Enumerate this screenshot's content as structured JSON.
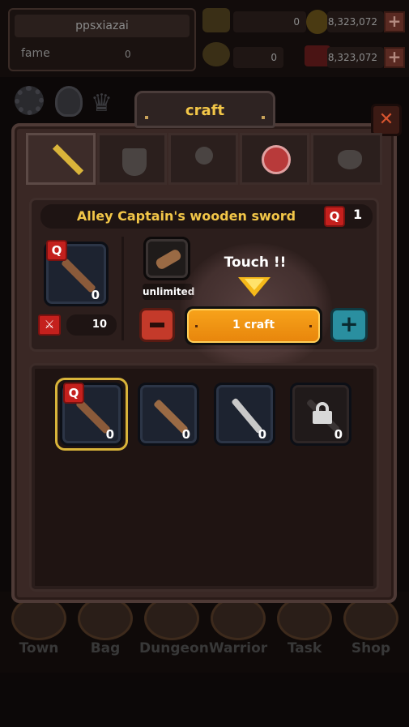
{
  "profile": {
    "name": "ppsxiazai",
    "fame_label": "fame",
    "fame_value": "0"
  },
  "resources": {
    "gold_bar": "0",
    "gold_coin": "8,323,072",
    "trophy": "0",
    "gem": "8,323,072"
  },
  "dialog": {
    "title": "craft",
    "item_name": "Alley Captain's wooden sword",
    "quality_badge": "Q",
    "quality_count": "1",
    "owned_count": "0",
    "stock_count": "10",
    "material_label": "unlimited",
    "touch_hint": "Touch !!",
    "craft_button": "1 craft",
    "plus_symbol": "+",
    "close_symbol": "✕"
  },
  "recipes": [
    {
      "count": "0",
      "badge": "Q"
    },
    {
      "count": "0"
    },
    {
      "count": "0"
    },
    {
      "count": "0"
    }
  ],
  "bottom_nav": {
    "town": "Town",
    "bag": "Bag",
    "dungeon": "Dungeon",
    "warrior": "Warrior",
    "task": "Task",
    "shop": "Shop"
  },
  "colors": {
    "accent_gold": "#f2c648",
    "craft_orange": "#f7a21a",
    "minus_red": "#c43a2a",
    "plus_teal": "#2a8fa0",
    "quality_red": "#c4201d"
  },
  "icons": {
    "tabs": [
      "sword-icon",
      "shield-icon",
      "staff-icon",
      "locked-tab-icon",
      "pet-icon"
    ],
    "top": [
      "settings-gear-icon",
      "medal-icon",
      "crown-icon"
    ]
  }
}
